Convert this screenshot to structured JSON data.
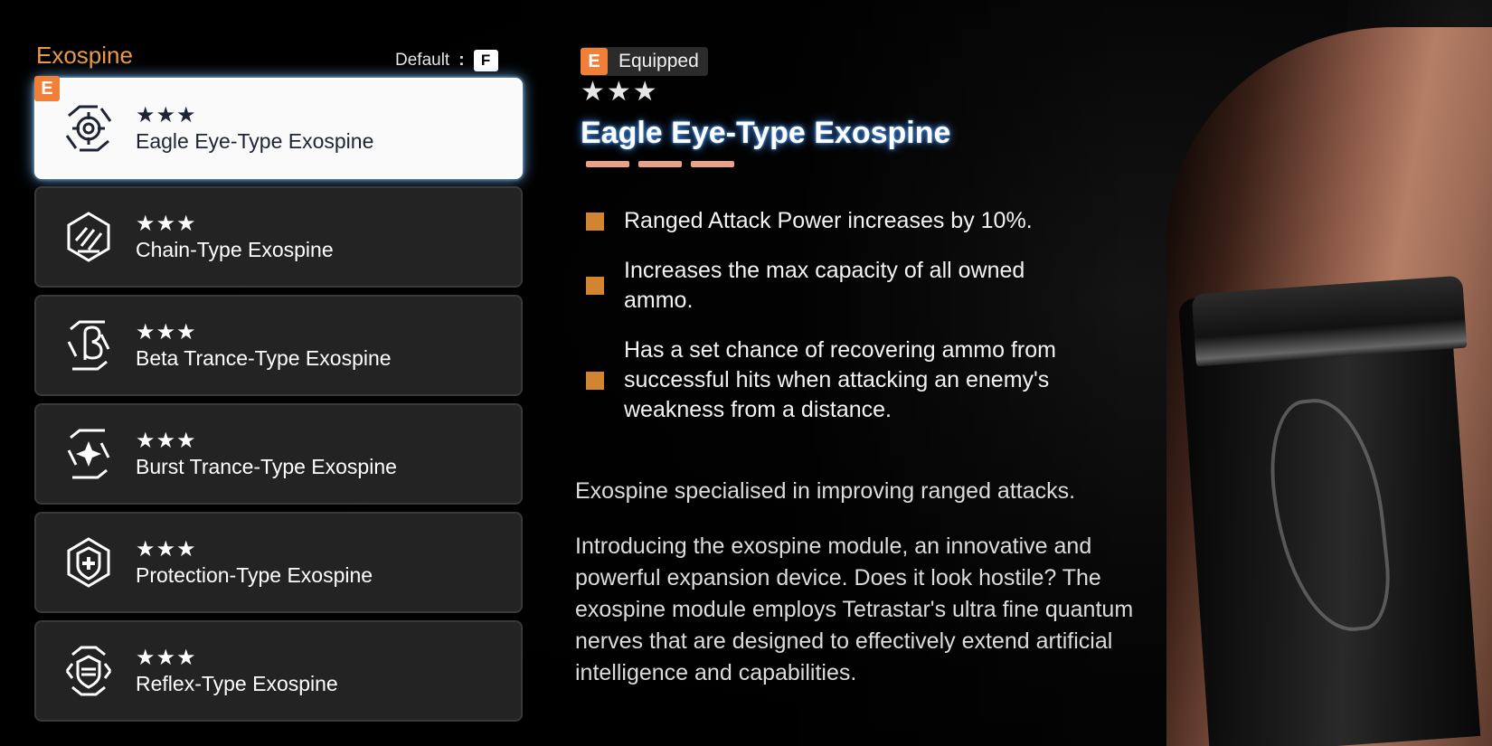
{
  "panel": {
    "title": "Exospine",
    "default_label": "Default",
    "default_key": "F"
  },
  "items": [
    {
      "name": "Eagle Eye-Type Exospine",
      "stars": "★★★",
      "icon": "crosshair-icon",
      "equipped": true,
      "selected": true
    },
    {
      "name": "Chain-Type Exospine",
      "stars": "★★★",
      "icon": "chain-claw-icon",
      "equipped": false,
      "selected": false
    },
    {
      "name": "Beta Trance-Type Exospine",
      "stars": "★★★",
      "icon": "beta-icon",
      "equipped": false,
      "selected": false
    },
    {
      "name": "Burst Trance-Type Exospine",
      "stars": "★★★",
      "icon": "burst-star-icon",
      "equipped": false,
      "selected": false
    },
    {
      "name": "Protection-Type Exospine",
      "stars": "★★★",
      "icon": "shield-plus-icon",
      "equipped": false,
      "selected": false
    },
    {
      "name": "Reflex-Type Exospine",
      "stars": "★★★",
      "icon": "reflex-shield-icon",
      "equipped": false,
      "selected": false
    }
  ],
  "badge_letter": "E",
  "detail": {
    "equipped_label": "Equipped",
    "stars": "★★★",
    "title": "Eagle Eye-Type Exospine",
    "rank_bars": 3,
    "effects": [
      "Ranged Attack Power increases by 10%.",
      "Increases the max capacity of all owned ammo.",
      "Has a set chance of recovering ammo from successful hits when attacking an enemy's weakness from a distance."
    ],
    "description": [
      "Exospine specialised in improving ranged attacks.",
      "Introducing the exospine module, an innovative and powerful expansion device. Does it look hostile? The exospine module employs Tetrastar's ultra fine quantum nerves that are designed to effectively extend artificial intelligence and capabilities."
    ]
  },
  "colors": {
    "accent_orange": "#e89a4a",
    "badge_orange": "#f07f3a",
    "bullet": "#d28531",
    "title_glow": "#4696ff",
    "rank_bar": "#e9a28a",
    "card_bg": "#232323",
    "card_selected_bg": "#fafafa"
  }
}
